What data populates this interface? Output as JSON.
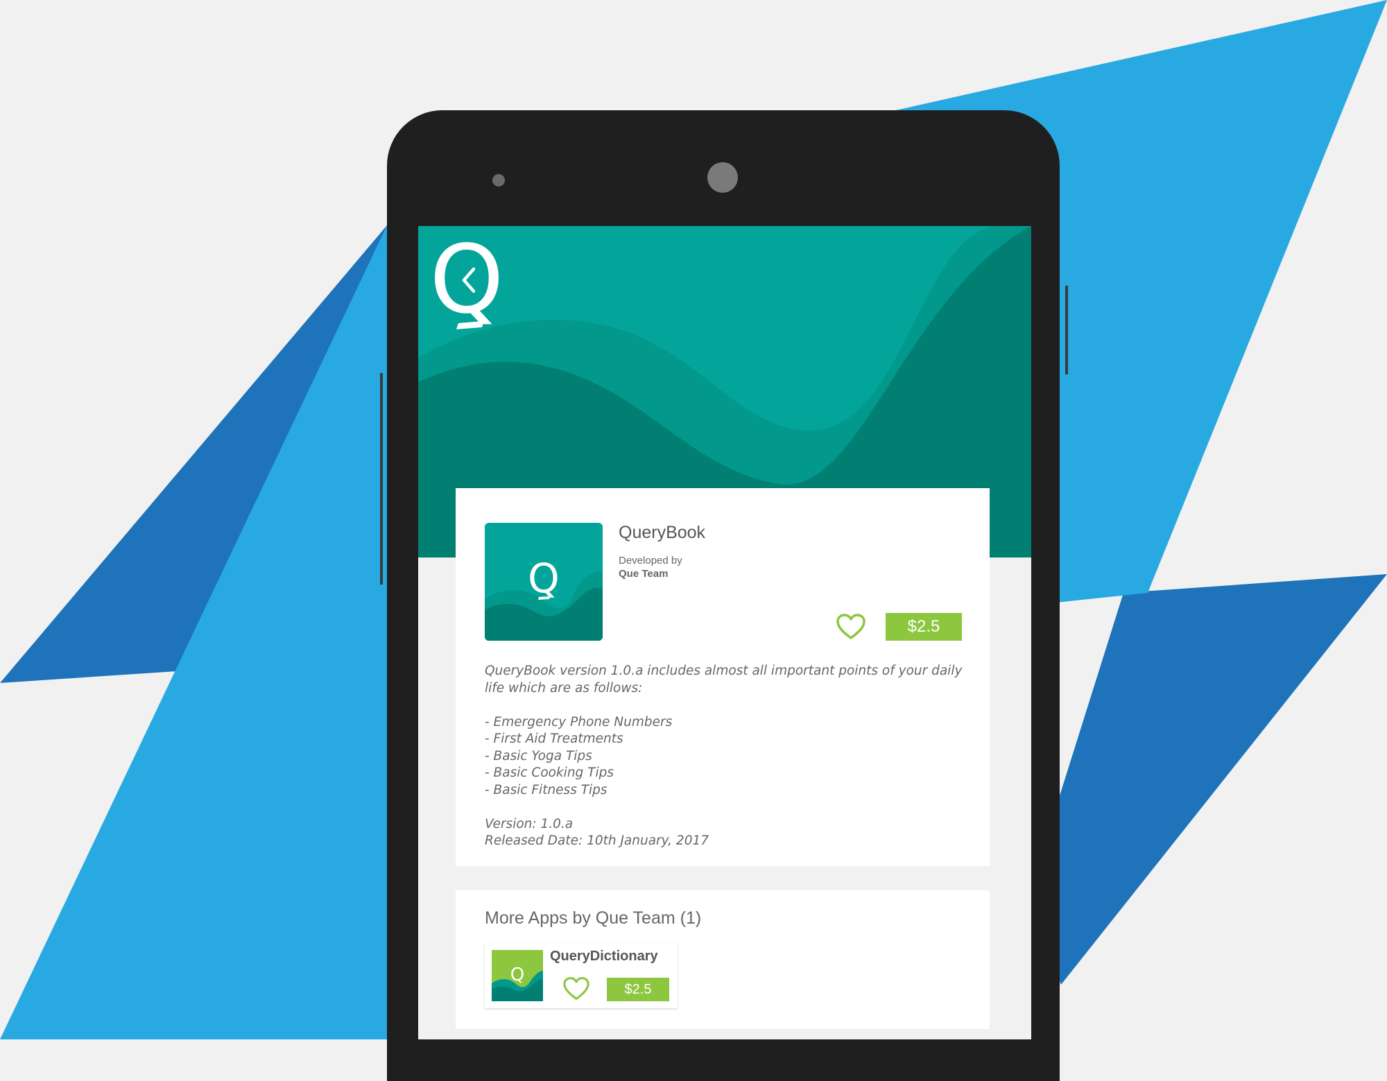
{
  "colors": {
    "background": "#f1f1f1",
    "bg_light_blue": "#29a9e1",
    "bg_dark_blue": "#1e73ba",
    "phone_body": "#1f1f1f",
    "teal": "#03a59a",
    "teal_dark": "#017f72",
    "green_accent": "#8dc63f"
  },
  "header": {
    "back_icon": "chevron-left-icon",
    "logo_letter": "Q"
  },
  "app": {
    "name": "QueryBook",
    "developed_by_label": "Developed by",
    "developer": "Que Team",
    "price": "$2.5",
    "favorite_icon": "heart-outline-icon",
    "icon_letter": "Q",
    "description": {
      "intro_line1": "QueryBook version 1.0.a includes almost all important points of  your daily",
      "intro_line2": "life which are as follows:",
      "features": [
        "- Emergency Phone Numbers",
        "- First Aid Treatments",
        "- Basic Yoga Tips",
        "- Basic Cooking Tips",
        "- Basic Fitness Tips"
      ],
      "version": "Version: 1.0.a",
      "released": "Released Date: 10th January, 2017"
    }
  },
  "more_apps": {
    "title": "More Apps by Que Team (1)",
    "items": [
      {
        "name": "QueryDictionary",
        "price": "$2.5",
        "icon_letter": "Q",
        "favorite_icon": "heart-outline-icon"
      }
    ]
  }
}
